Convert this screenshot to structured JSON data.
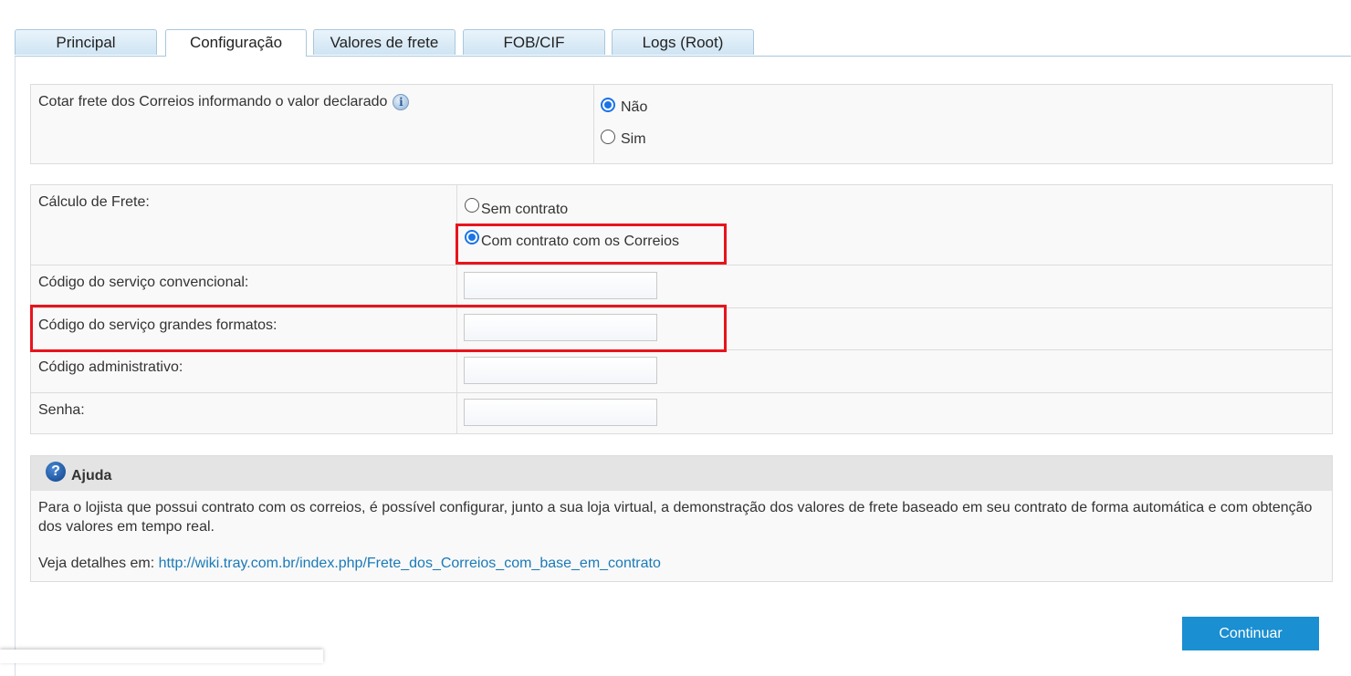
{
  "tabs": [
    {
      "label": "Principal",
      "active": false
    },
    {
      "label": "Configuração",
      "active": true
    },
    {
      "label": "Valores de frete",
      "active": false
    },
    {
      "label": "FOB/CIF",
      "active": false
    },
    {
      "label": "Logs (Root)",
      "active": false
    }
  ],
  "declared_value": {
    "label": "Cotar frete dos Correios informando o valor declarado",
    "info_icon": "info-icon",
    "options": [
      {
        "label": "Não",
        "checked": true
      },
      {
        "label": "Sim",
        "checked": false
      }
    ]
  },
  "freight": {
    "calc_label": "Cálculo de Frete:",
    "options": [
      {
        "label": "Sem contrato",
        "checked": false
      },
      {
        "label": "Com contrato com os Correios",
        "checked": true
      }
    ],
    "fields": [
      {
        "label": "Código do serviço convencional:",
        "value": ""
      },
      {
        "label": "Código do serviço grandes formatos:",
        "value": ""
      },
      {
        "label": "Código administrativo:",
        "value": ""
      },
      {
        "label": "Senha:",
        "value": ""
      }
    ]
  },
  "help": {
    "title": "Ajuda",
    "icon": "question-icon",
    "text": "Para o lojista que possui contrato com os correios, é possível configurar, junto a sua loja virtual, a demonstração dos valores de frete baseado em seu contrato de forma automática e com obtenção dos valores em tempo real.",
    "link_prefix": "Veja detalhes em:",
    "link_text": "http://wiki.tray.com.br/index.php/Frete_dos_Correios_com_base_em_contrato"
  },
  "actions": {
    "continue_label": "Continuar"
  },
  "colors": {
    "accent": "#1a8fd1",
    "highlight": "#e8141c",
    "link": "#1a7ab8"
  }
}
